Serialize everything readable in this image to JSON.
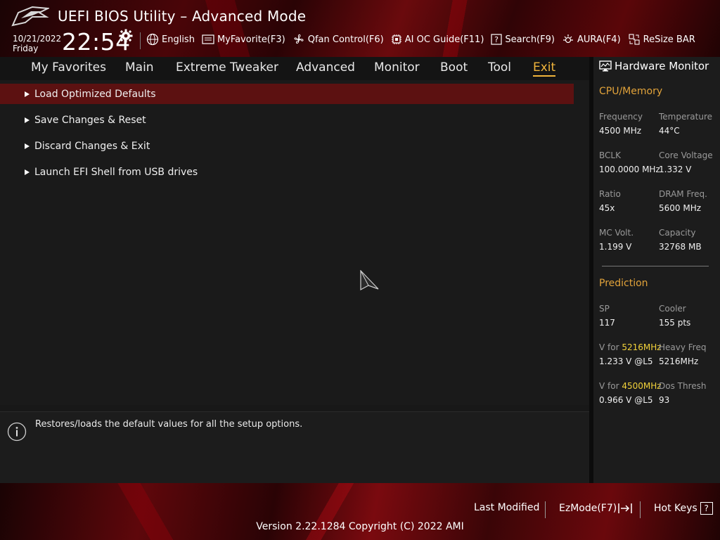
{
  "header": {
    "title": "UEFI BIOS Utility – Advanced Mode",
    "date": "10/21/2022",
    "day": "Friday",
    "time": "22:54",
    "tools": [
      {
        "label": "English",
        "icon": "globe-icon"
      },
      {
        "label": "MyFavorite(F3)",
        "icon": "favorite-icon"
      },
      {
        "label": "Qfan Control(F6)",
        "icon": "fan-icon"
      },
      {
        "label": "AI OC Guide(F11)",
        "icon": "ai-chip-icon"
      },
      {
        "label": "Search(F9)",
        "icon": "search-help-icon"
      },
      {
        "label": "AURA(F4)",
        "icon": "aura-light-icon"
      },
      {
        "label": "ReSize BAR",
        "icon": "resize-bar-icon"
      }
    ]
  },
  "tabs": [
    {
      "label": "My Favorites"
    },
    {
      "label": "Main"
    },
    {
      "label": "Extreme Tweaker"
    },
    {
      "label": "Advanced"
    },
    {
      "label": "Monitor"
    },
    {
      "label": "Boot"
    },
    {
      "label": "Tool"
    },
    {
      "label": "Exit",
      "active": true
    }
  ],
  "menu": [
    {
      "label": "Load Optimized Defaults",
      "selected": true
    },
    {
      "label": "Save Changes & Reset"
    },
    {
      "label": "Discard Changes & Exit"
    },
    {
      "label": "Launch EFI Shell from USB drives"
    }
  ],
  "help": {
    "text": "Restores/loads the default values for all the setup options."
  },
  "hardware_monitor": {
    "title": "Hardware Monitor",
    "cpu_memory": {
      "heading": "CPU/Memory",
      "items": [
        {
          "label": "Frequency",
          "value": "4500 MHz"
        },
        {
          "label": "Temperature",
          "value": "44°C"
        },
        {
          "label": "BCLK",
          "value": "100.0000 MHz"
        },
        {
          "label": "Core Voltage",
          "value": "1.332 V"
        },
        {
          "label": "Ratio",
          "value": "45x"
        },
        {
          "label": "DRAM Freq.",
          "value": "5600 MHz"
        },
        {
          "label": "MC Volt.",
          "value": "1.199 V"
        },
        {
          "label": "Capacity",
          "value": "32768 MB"
        }
      ]
    },
    "prediction": {
      "heading": "Prediction",
      "sp_label": "SP",
      "sp_value": "117",
      "cooler_label": "Cooler",
      "cooler_value": "155 pts",
      "v_for_prefix": "V for ",
      "v1_freq": "5216MHz",
      "v1_value": "1.233 V @L5",
      "heavy_freq_label": "Heavy Freq",
      "heavy_freq_value": "5216MHz",
      "v2_freq": "4500MHz",
      "v2_value": "0.966 V @L5",
      "dos_thresh_label": "Dos Thresh",
      "dos_thresh_value": "93"
    }
  },
  "footer": {
    "last_modified": "Last Modified",
    "ezmode": "EzMode(F7)",
    "hot_keys": "Hot Keys",
    "hot_keys_symbol": "?",
    "version": "Version 2.22.1284 Copyright (C) 2022 AMI"
  },
  "colors": {
    "accent": "#f0b43b",
    "selected_row": "#5c1111",
    "section_heading": "#e2a33a",
    "highlight_freq": "#f2d23a"
  }
}
